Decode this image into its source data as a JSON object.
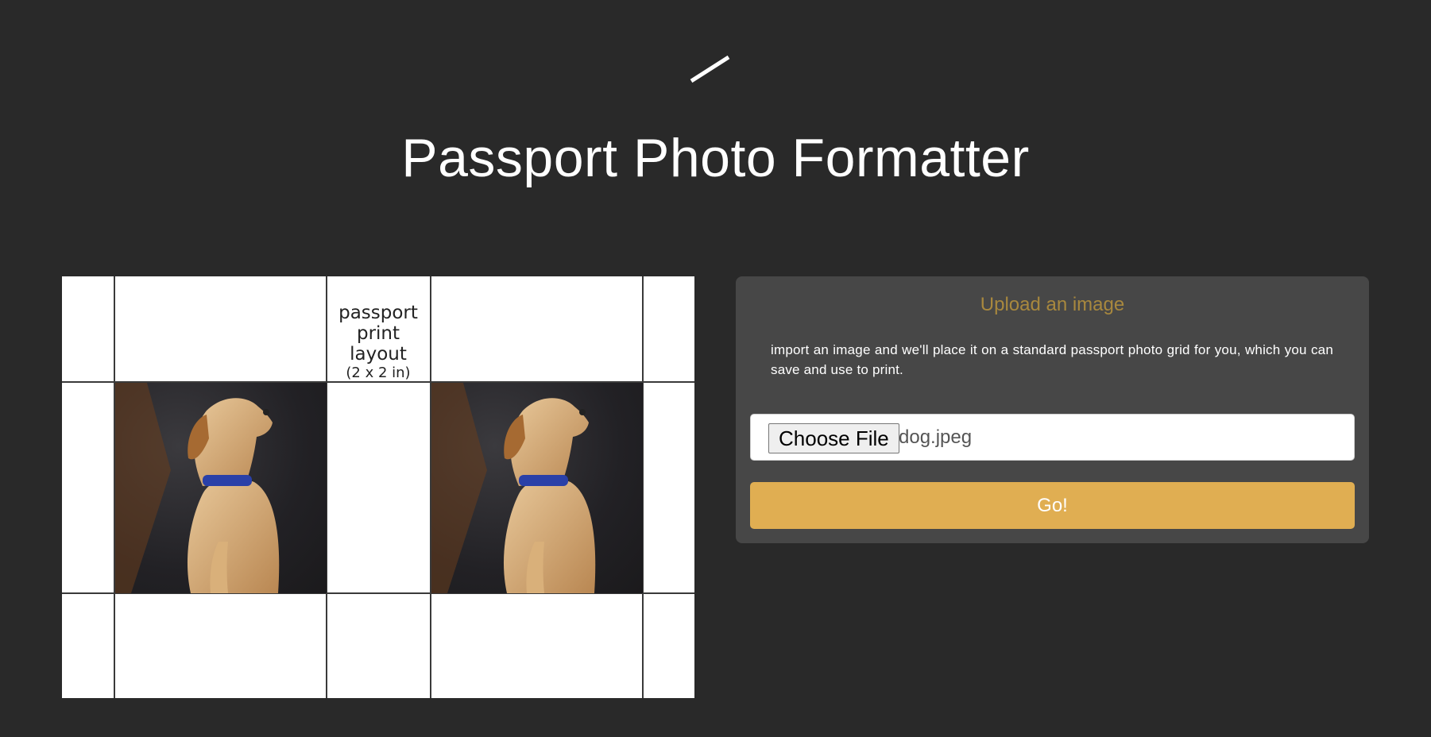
{
  "header": {
    "logo_icon": "slash-logo-icon",
    "title": "Passport Photo Formatter"
  },
  "grid": {
    "label_line1": "passport",
    "label_line2": "print layout",
    "label_line3": "(2 x 2 in)",
    "photos": [
      {
        "subject": "dog photo"
      },
      {
        "subject": "dog photo"
      }
    ]
  },
  "panel": {
    "heading": "Upload an image",
    "description": "import an image and we'll place it on a standard passport photo grid for you, which you can save and use to print.",
    "file_button_label": "Choose File",
    "file_name": "dog.jpeg",
    "go_label": "Go!"
  },
  "colors": {
    "background": "#292929",
    "panel": "#474747",
    "accent": "#e0ae52",
    "heading": "#a8883e"
  }
}
